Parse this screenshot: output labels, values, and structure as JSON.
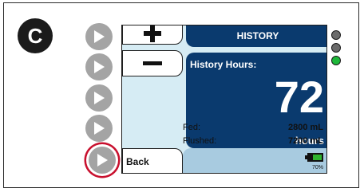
{
  "panel_label": "C",
  "screen": {
    "plus_label": "+",
    "minus_label": "−",
    "back_label": "Back",
    "header_title": "HISTORY",
    "history_hours_label": "History Hours:",
    "history_hours_value": "72",
    "history_hours_unit": "hours",
    "fed_label": "Fed:",
    "fed_value": "2800 mL",
    "flushed_label": "Flushed:",
    "flushed_value": "7200 mL",
    "battery_percent_label": "70%",
    "battery_level": 0.7
  },
  "soft_keys": [
    {
      "name": "soft-key-1",
      "icon": "play-triangle-icon"
    },
    {
      "name": "soft-key-2",
      "icon": "play-triangle-icon"
    },
    {
      "name": "soft-key-3",
      "icon": "play-triangle-icon"
    },
    {
      "name": "soft-key-4",
      "icon": "play-triangle-icon"
    },
    {
      "name": "soft-key-back",
      "icon": "play-triangle-icon",
      "highlighted": true
    }
  ],
  "status_leds": [
    {
      "name": "led-1",
      "color": "#6b6b6b"
    },
    {
      "name": "led-2",
      "color": "#6b6b6b"
    },
    {
      "name": "led-3",
      "color": "#1eb83a"
    }
  ],
  "colors": {
    "header_navy": "#0a3a6e",
    "screen_light_blue": "#d6ecf4",
    "status_bar_blue": "#a8cbe0",
    "highlight_red": "#c8102e",
    "soft_key_gray": "#a4a4a4"
  }
}
